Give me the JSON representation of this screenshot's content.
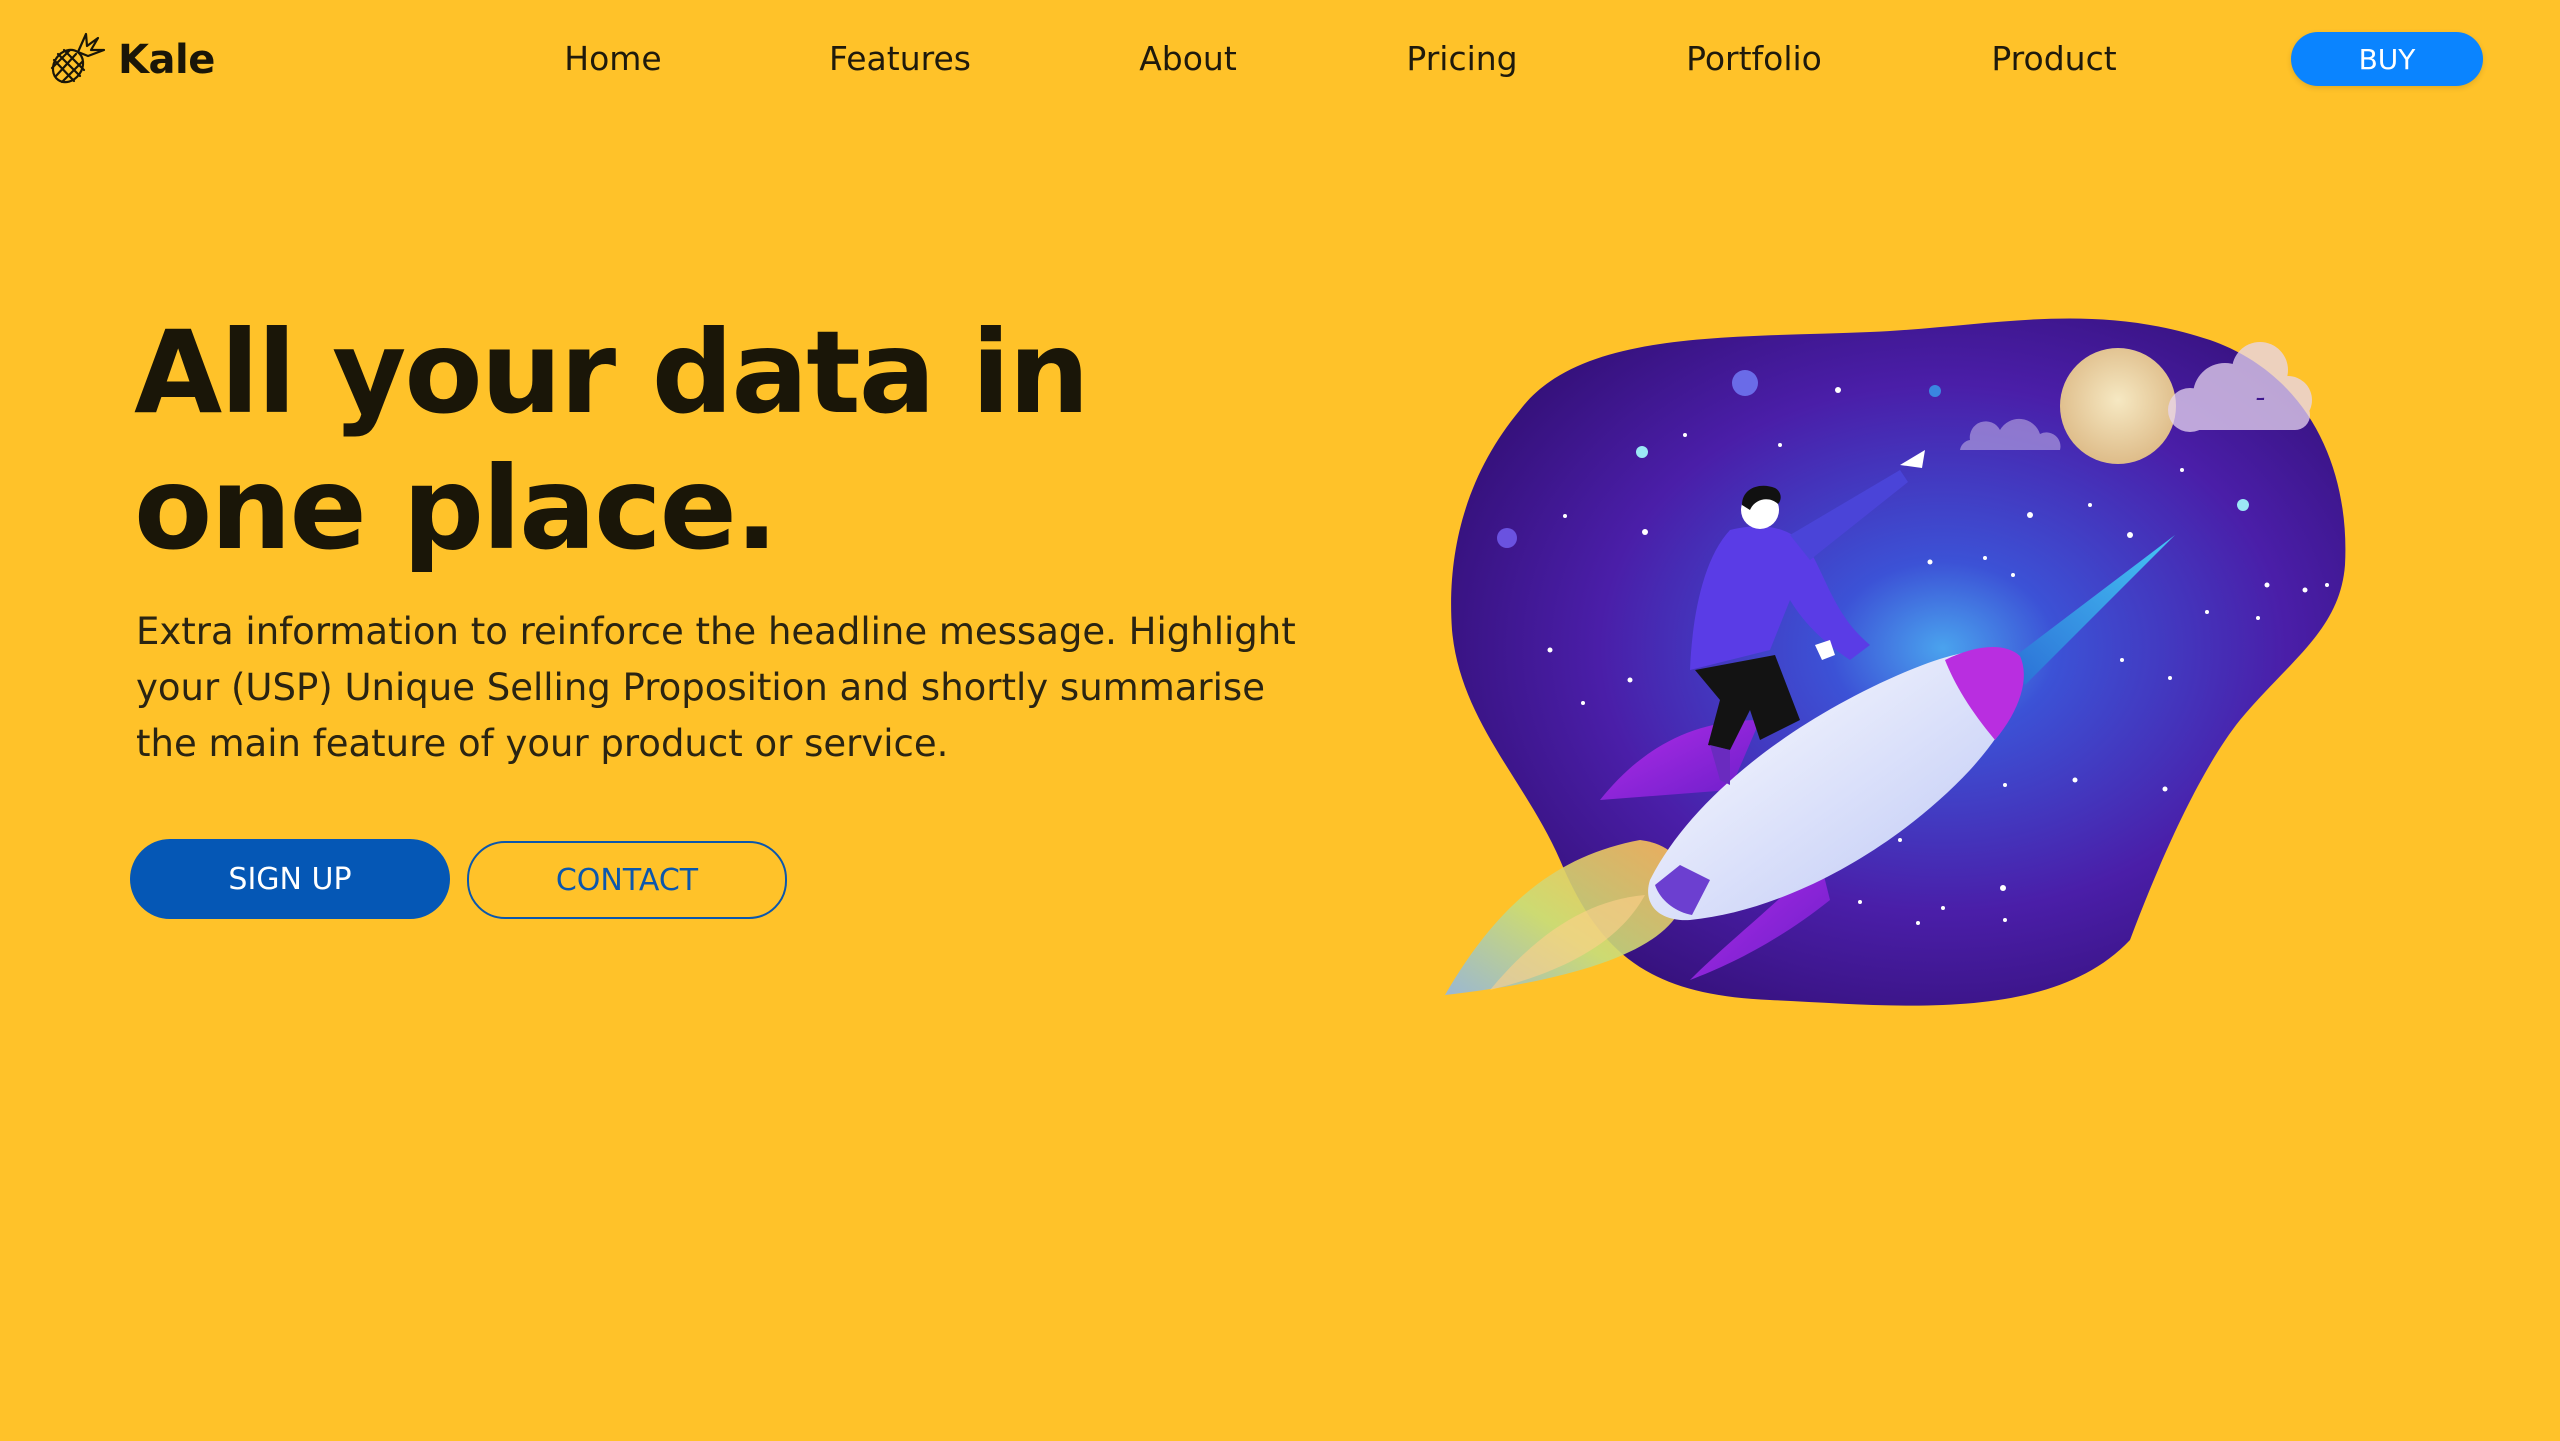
{
  "brand": {
    "name": "Kale",
    "logo_icon": "pineapple-icon"
  },
  "nav": {
    "items": [
      {
        "label": "Home"
      },
      {
        "label": "Features"
      },
      {
        "label": "About"
      },
      {
        "label": "Pricing"
      },
      {
        "label": "Portfolio"
      },
      {
        "label": "Product"
      }
    ],
    "buy_label": "BUY"
  },
  "hero": {
    "title": "All your data in one place.",
    "description": "Extra information to reinforce the headline message. Highlight your (USP) Unique Selling Proposition and shortly summarise the main feature of your product or service.",
    "signup_label": "SIGN UP",
    "contact_label": "CONTACT",
    "illustration": "rocket-rider-illustration"
  },
  "colors": {
    "background": "#ffc229",
    "primary_button": "#0557b5",
    "buy_button": "#0a84ff",
    "text": "#1a1608"
  }
}
